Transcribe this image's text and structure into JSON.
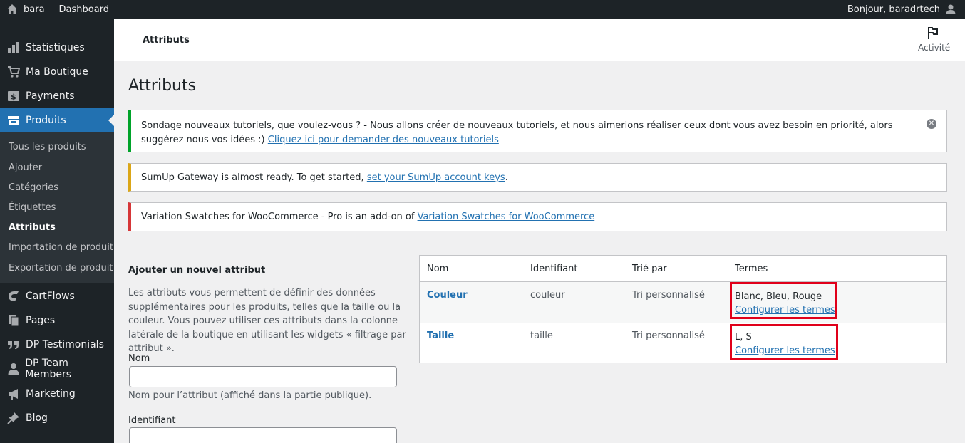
{
  "adminbar": {
    "site_name": "bara",
    "dashboard": "Dashboard",
    "greeting": "Bonjour, baradrtech"
  },
  "sidebar": {
    "items": [
      {
        "label": "Statistiques",
        "icon": "chart-bar-icon"
      },
      {
        "label": "Ma Boutique",
        "icon": "cart-icon"
      },
      {
        "label": "Payments",
        "icon": "dollar-icon"
      },
      {
        "label": "Produits",
        "icon": "archive-icon"
      },
      {
        "label": "CartFlows",
        "icon": "cartflows-icon"
      },
      {
        "label": "Pages",
        "icon": "pages-icon"
      },
      {
        "label": "DP Testimonials",
        "icon": "quote-icon"
      },
      {
        "label": "DP Team Members",
        "icon": "user-icon"
      },
      {
        "label": "Marketing",
        "icon": "megaphone-icon"
      },
      {
        "label": "Blog",
        "icon": "pin-icon"
      }
    ],
    "submenu": [
      "Tous les produits",
      "Ajouter",
      "Catégories",
      "Étiquettes",
      "Attributs",
      "Importation de produit",
      "Exportation de produit"
    ]
  },
  "header": {
    "breadcrumb": "Attributs",
    "activity_label": "Activité"
  },
  "page": {
    "title": "Attributs"
  },
  "notices": {
    "survey_bold": "Sondage nouveaux tutoriels, que voulez-vous ?",
    "survey_text": " - Nous allons créer de nouveaux tutoriels, et nous aimerions réaliser ceux dont vous avez besoin en priorité, alors suggérez nous vos idées :) ",
    "survey_link": "Cliquez ici pour demander des nouveaux tutoriels",
    "sumup_text": "SumUp Gateway is almost ready. To get started, ",
    "sumup_link": "set your SumUp account keys",
    "sumup_end": ".",
    "swatches_text": "Variation Swatches for WooCommerce - Pro is an add-on of ",
    "swatches_link": "Variation Swatches for WooCommerce"
  },
  "form": {
    "title": "Ajouter un nouvel attribut",
    "description": "Les attributs vous permettent de définir des données supplémentaires pour les produits, telles que la taille ou la couleur. Vous pouvez utiliser ces attributs dans la colonne latérale de la boutique en utilisant les widgets « filtrage par attribut ».",
    "name_label": "Nom",
    "name_value": "",
    "name_help": "Nom pour l’attribut (affiché dans la partie publique).",
    "slug_label": "Identifiant",
    "slug_value": ""
  },
  "table": {
    "headers": [
      "Nom",
      "Identifiant",
      "Trié par",
      "Termes"
    ],
    "rows": [
      {
        "name": "Couleur",
        "slug": "couleur",
        "order": "Tri personnalisé",
        "terms": "Blanc, Bleu, Rouge",
        "configure": "Configurer les termes"
      },
      {
        "name": "Taille",
        "slug": "taille",
        "order": "Tri personnalisé",
        "terms": "L, S",
        "configure": "Configurer les termes"
      }
    ]
  },
  "colors": {
    "accent": "#2271b1",
    "highlight_box": "#e0001a",
    "notice_green": "#00a32a",
    "notice_yellow": "#dba617",
    "notice_red": "#d63638"
  }
}
